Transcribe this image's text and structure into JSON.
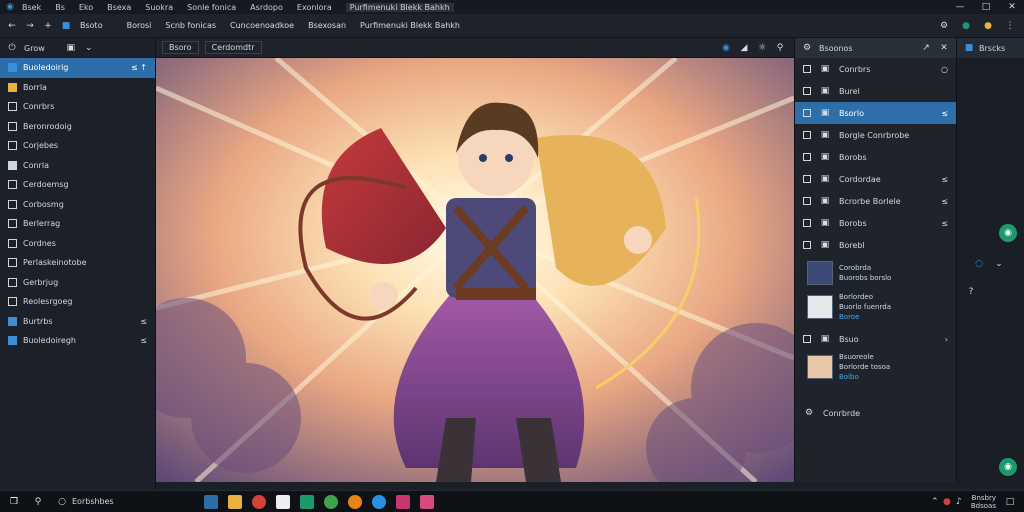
{
  "menubar": {
    "items": [
      "Bsek",
      "Bs",
      "Eko",
      "Bsexa",
      "Suokra",
      "Sonle fonica",
      "Asrdopo",
      "Exonlora",
      "Purfimenuki Blekk Bahkh"
    ]
  },
  "toolbar": {
    "labels": [
      "Bsoto",
      "Borosi",
      "Scnb fonicas",
      "Cuncoenoadkoe",
      "Bsexosan",
      "Purfimenuki Blekk Bahkh"
    ]
  },
  "left_panel": {
    "head_label": "Grow",
    "items": [
      {
        "label": "Buoledoirig",
        "right": "≤ ↑",
        "selected": true,
        "icon": "blue"
      },
      {
        "label": "Borrla",
        "right": "",
        "selected": false,
        "icon": "yellow"
      },
      {
        "label": "Conrbrs",
        "right": "",
        "selected": false,
        "icon": "outline"
      },
      {
        "label": "Beronrodoig",
        "right": "",
        "selected": false,
        "icon": "outline"
      },
      {
        "label": "Corjebes",
        "right": "",
        "selected": false,
        "icon": "outline"
      },
      {
        "label": "Conrla",
        "right": "",
        "selected": false,
        "icon": "fill"
      },
      {
        "label": "Cerdoemsg",
        "right": "",
        "selected": false,
        "icon": "outline"
      },
      {
        "label": "Corbosmg",
        "right": "",
        "selected": false,
        "icon": "outline"
      },
      {
        "label": "Berlerrag",
        "right": "",
        "selected": false,
        "icon": "outline"
      },
      {
        "label": "Cordnes",
        "right": "",
        "selected": false,
        "icon": "outline"
      },
      {
        "label": "Perlaskeinotobe",
        "right": "",
        "selected": false,
        "icon": "outline"
      },
      {
        "label": "Gerbrjug",
        "right": "",
        "selected": false,
        "icon": "outline"
      },
      {
        "label": "Reolesrgoeg",
        "right": "",
        "selected": false,
        "icon": "outline"
      },
      {
        "label": "Burtrbs",
        "right": "≤",
        "selected": false,
        "icon": "blue"
      },
      {
        "label": "Buoledoiregh",
        "right": "≤",
        "selected": false,
        "icon": "blue"
      }
    ]
  },
  "canvas_head": {
    "tab1": "Bsoro",
    "tab2": "Cerdomdtr"
  },
  "right_panel": {
    "head_label": "Bsoonos",
    "items": [
      {
        "label": "Conrbrs",
        "right": "○",
        "selected": false
      },
      {
        "label": "Burel",
        "right": "",
        "selected": false
      },
      {
        "label": "Bsorlo",
        "right": "≤",
        "selected": true
      },
      {
        "label": "Borgle Conrbrobe",
        "right": "",
        "selected": false
      },
      {
        "label": "Borobs",
        "right": "",
        "selected": false
      },
      {
        "label": "Cordordae",
        "right": "≤",
        "selected": false
      },
      {
        "label": "Bcrorbe Borlele",
        "right": "≤",
        "selected": false
      },
      {
        "label": "Borobs",
        "right": "≤",
        "selected": false
      },
      {
        "label": "Borebl",
        "right": "",
        "selected": false
      }
    ],
    "thumb_items": [
      {
        "line1": "Corobrda",
        "line2": "Buorobs borslo"
      },
      {
        "line1": "Borlordeo",
        "line2": "Buorlo fuenrda",
        "line3": "Boroe"
      }
    ],
    "lower_item": {
      "label": "Bsuo",
      "right": "›"
    },
    "person_item": {
      "line1": "Bsuoreole",
      "line2": "Borlorde tosoa",
      "line3": "Bolbo"
    },
    "footer_label": "Conrbrde"
  },
  "far_right": {
    "head_label": "Brscks"
  },
  "taskbar": {
    "search_text": "Eorbshbes",
    "clock_line1": "Bnsbry",
    "clock_line2": "Bdsoas"
  },
  "colors": {
    "accent": "#2d6ea8",
    "green": "#1d9a6c",
    "panel": "#1f242c"
  }
}
